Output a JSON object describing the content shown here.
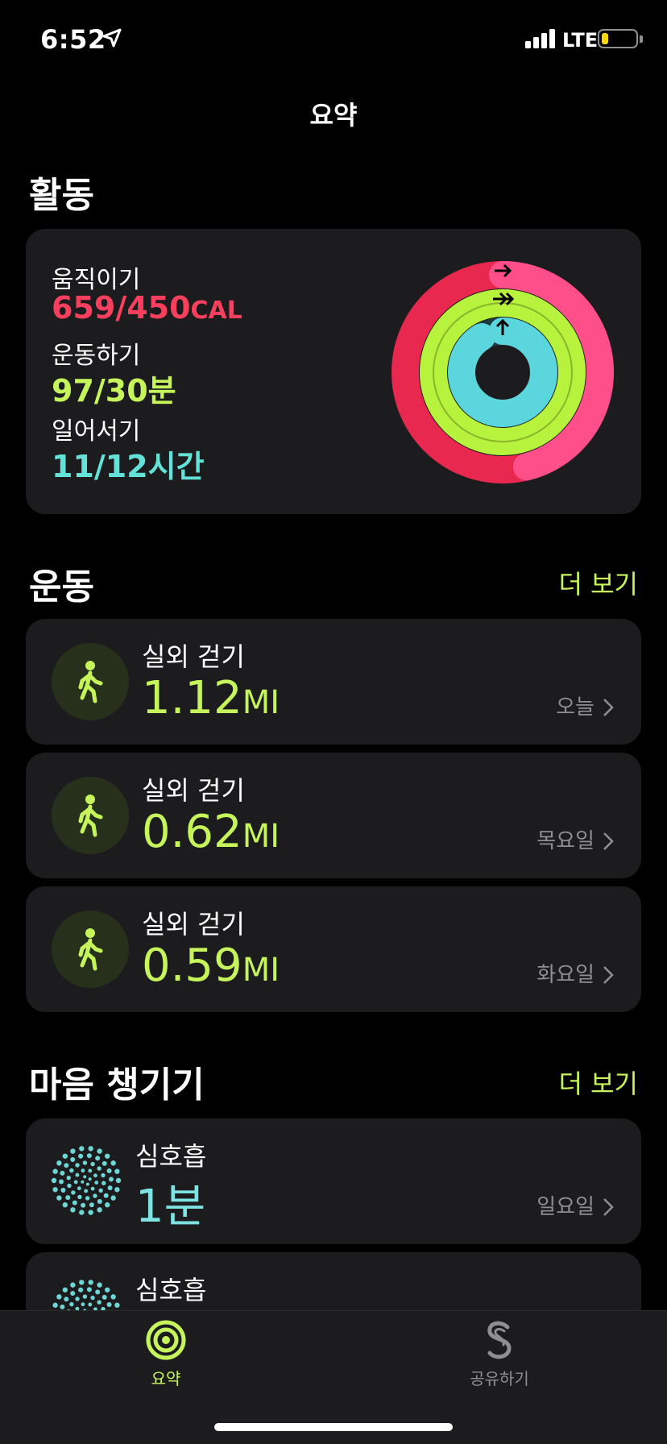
{
  "status": {
    "time": "6:52",
    "network": "LTE",
    "battery_level": 0.2
  },
  "nav": {
    "title": "요약"
  },
  "activity": {
    "section_title": "활동",
    "move": {
      "label": "움직이기",
      "value": "659/450",
      "unit": "CAL",
      "color": "#fa3f5e",
      "progress": 1.46
    },
    "exercise": {
      "label": "운동하기",
      "value": "97/30분",
      "color": "#c6f55b",
      "progress": 3.23
    },
    "stand": {
      "label": "일어서기",
      "value": "11/12시간",
      "color": "#63e2d8",
      "progress": 0.92
    }
  },
  "workouts": {
    "section_title": "운동",
    "more_label": "더 보기",
    "items": [
      {
        "name": "실외 걷기",
        "value": "1.12",
        "unit": "MI",
        "day": "오늘"
      },
      {
        "name": "실외 걷기",
        "value": "0.62",
        "unit": "MI",
        "day": "목요일"
      },
      {
        "name": "실외 걷기",
        "value": "0.59",
        "unit": "MI",
        "day": "화요일"
      }
    ]
  },
  "mindfulness": {
    "section_title": "마음 챙기기",
    "more_label": "더 보기",
    "items": [
      {
        "name": "심호흡",
        "value": "1분",
        "day": "일요일"
      },
      {
        "name": "심호흡"
      }
    ]
  },
  "tabbar": {
    "tabs": [
      {
        "label": "요약",
        "active": true,
        "icon": "activity-rings-icon"
      },
      {
        "label": "공유하기",
        "active": false,
        "icon": "sharing-icon"
      }
    ],
    "active_color": "#c6f55b",
    "inactive_color": "#8e8e93"
  }
}
